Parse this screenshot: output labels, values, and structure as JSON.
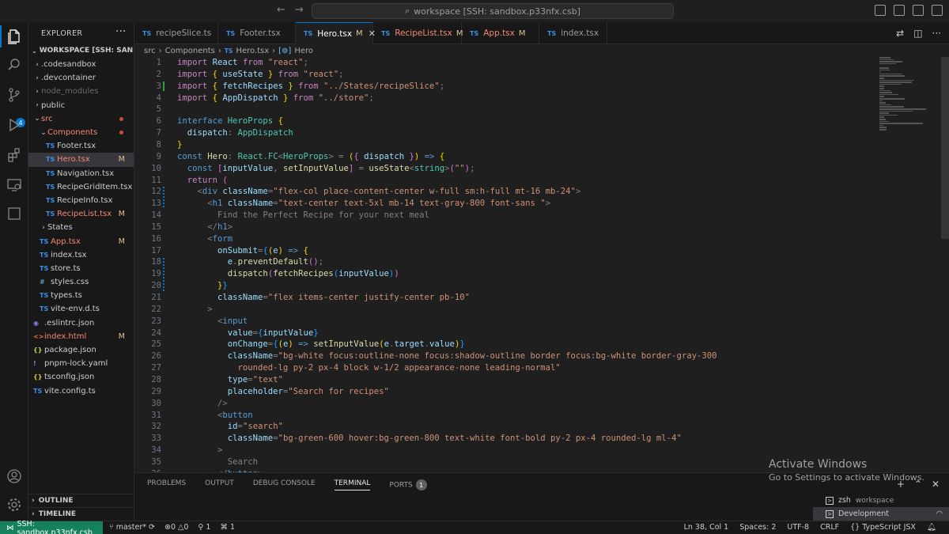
{
  "titlebar": {
    "search_text": "workspace [SSH: sandbox.p33nfx.csb]"
  },
  "activity": {
    "source_control_badge": "4"
  },
  "sidebar": {
    "title": "EXPLORER",
    "workspace": "WORKSPACE [SSH: SANDB...",
    "items": [
      {
        "label": ".codesandbox",
        "type": "folder",
        "indent": 1
      },
      {
        "label": ".devcontainer",
        "type": "folder",
        "indent": 1
      },
      {
        "label": "node_modules",
        "type": "folder",
        "indent": 1,
        "ignored": true
      },
      {
        "label": "public",
        "type": "folder",
        "indent": 1
      },
      {
        "label": "src",
        "type": "folder-open",
        "indent": 1,
        "status": "dot"
      },
      {
        "label": "Components",
        "type": "folder-open",
        "indent": 2,
        "status": "dot"
      },
      {
        "label": "Footer.tsx",
        "type": "ts",
        "indent": 3
      },
      {
        "label": "Hero.tsx",
        "type": "ts",
        "indent": 3,
        "mark": "M",
        "selected": true
      },
      {
        "label": "Navigation.tsx",
        "type": "ts",
        "indent": 3
      },
      {
        "label": "RecipeGridItem.tsx",
        "type": "ts",
        "indent": 3
      },
      {
        "label": "RecipeInfo.tsx",
        "type": "ts",
        "indent": 3
      },
      {
        "label": "RecipeList.tsx",
        "type": "ts",
        "indent": 3,
        "mark": "M"
      },
      {
        "label": "States",
        "type": "folder",
        "indent": 2
      },
      {
        "label": "App.tsx",
        "type": "ts",
        "indent": 2,
        "mark": "M"
      },
      {
        "label": "index.tsx",
        "type": "ts",
        "indent": 2
      },
      {
        "label": "store.ts",
        "type": "ts",
        "indent": 2
      },
      {
        "label": "styles.css",
        "type": "css",
        "indent": 2
      },
      {
        "label": "types.ts",
        "type": "ts",
        "indent": 2
      },
      {
        "label": "vite-env.d.ts",
        "type": "ts",
        "indent": 2
      },
      {
        "label": ".eslintrc.json",
        "type": "eslint",
        "indent": 1
      },
      {
        "label": "index.html",
        "type": "html",
        "indent": 1,
        "mark": "M"
      },
      {
        "label": "package.json",
        "type": "json",
        "indent": 1
      },
      {
        "label": "pnpm-lock.yaml",
        "type": "yaml",
        "indent": 1
      },
      {
        "label": "tsconfig.json",
        "type": "json",
        "indent": 1
      },
      {
        "label": "vite.config.ts",
        "type": "ts",
        "indent": 1
      }
    ],
    "outline": "OUTLINE",
    "timeline": "TIMELINE"
  },
  "tabs": [
    {
      "label": "recipeSlice.ts",
      "state": "normal"
    },
    {
      "label": "Footer.tsx",
      "state": "normal"
    },
    {
      "label": "Hero.tsx",
      "state": "active",
      "mark": "M"
    },
    {
      "label": "RecipeList.tsx",
      "state": "mod2",
      "mark": "M"
    },
    {
      "label": "App.tsx",
      "state": "mod",
      "mark": "M"
    },
    {
      "label": "index.tsx",
      "state": "normal"
    }
  ],
  "breadcrumb": {
    "part1": "src",
    "part2": "Components",
    "part3": "Hero.tsx",
    "part4": "Hero"
  },
  "code_lines": [
    [
      [
        "kw2",
        "import "
      ],
      [
        "var",
        "React "
      ],
      [
        "kw2",
        "from "
      ],
      [
        "str",
        "\"react\""
      ],
      [
        "punc",
        ";"
      ]
    ],
    [
      [
        "kw2",
        "import "
      ],
      [
        "br1",
        "{ "
      ],
      [
        "var",
        "useState "
      ],
      [
        "br1",
        "} "
      ],
      [
        "kw2",
        "from "
      ],
      [
        "str",
        "\"react\""
      ],
      [
        "punc",
        ";"
      ]
    ],
    [
      [
        "kw2",
        "import "
      ],
      [
        "br1",
        "{ "
      ],
      [
        "var",
        "fetchRecipes "
      ],
      [
        "br1",
        "} "
      ],
      [
        "kw2",
        "from "
      ],
      [
        "str",
        "\"../States/recipeSlice\""
      ],
      [
        "punc",
        ";"
      ]
    ],
    [
      [
        "kw2",
        "import "
      ],
      [
        "br1",
        "{ "
      ],
      [
        "var",
        "AppDispatch "
      ],
      [
        "br1",
        "} "
      ],
      [
        "kw2",
        "from "
      ],
      [
        "str",
        "\"../store\""
      ],
      [
        "punc",
        ";"
      ]
    ],
    [],
    [
      [
        "kw",
        "interface "
      ],
      [
        "type",
        "HeroProps "
      ],
      [
        "br1",
        "{"
      ]
    ],
    [
      [
        "var",
        "  dispatch"
      ],
      [
        "punc",
        ": "
      ],
      [
        "type",
        "AppDispatch"
      ]
    ],
    [
      [
        "br1",
        "}"
      ]
    ],
    [
      [
        "kw",
        "const "
      ],
      [
        "fn",
        "Hero"
      ],
      [
        "punc",
        ": "
      ],
      [
        "type",
        "React"
      ],
      [
        "punc",
        "."
      ],
      [
        "type",
        "FC"
      ],
      [
        "punc",
        "<"
      ],
      [
        "type",
        "HeroProps"
      ],
      [
        "punc",
        "> = "
      ],
      [
        "br1",
        "("
      ],
      [
        "br2",
        "{ "
      ],
      [
        "var",
        "dispatch "
      ],
      [
        "br2",
        "}"
      ],
      [
        "br1",
        ") "
      ],
      [
        "kw",
        "=> "
      ],
      [
        "br1",
        "{"
      ]
    ],
    [
      [
        "kw",
        "  const "
      ],
      [
        "br2",
        "["
      ],
      [
        "var",
        "inputValue"
      ],
      [
        "punc",
        ", "
      ],
      [
        "fn",
        "setInputValue"
      ],
      [
        "br2",
        "] "
      ],
      [
        "punc",
        "= "
      ],
      [
        "fn",
        "useState"
      ],
      [
        "punc",
        "<"
      ],
      [
        "type",
        "string"
      ],
      [
        "punc",
        ">"
      ],
      [
        "br2",
        "("
      ],
      [
        "str",
        "\"\""
      ],
      [
        "br2",
        ")"
      ],
      [
        "punc",
        ";"
      ]
    ],
    [
      [
        "kw2",
        "  return "
      ],
      [
        "br2",
        "("
      ]
    ],
    [
      [
        "punc",
        "    <"
      ],
      [
        "tag",
        "div "
      ],
      [
        "attr",
        "className"
      ],
      [
        "punc",
        "="
      ],
      [
        "str",
        "\"flex-col place-content-center w-full sm:h-full mt-16 mb-24\""
      ],
      [
        "punc",
        ">"
      ]
    ],
    [
      [
        "punc",
        "      <"
      ],
      [
        "tag",
        "h1 "
      ],
      [
        "attr",
        "className"
      ],
      [
        "punc",
        "="
      ],
      [
        "str",
        "\"text-center text-5xl mb-14 text-gray-800 font-sans \""
      ],
      [
        "punc",
        ">"
      ]
    ],
    [
      [
        "punc",
        "        Find the Perfect Recipe for your next meal"
      ]
    ],
    [
      [
        "punc",
        "      </"
      ],
      [
        "tag",
        "h1"
      ],
      [
        "punc",
        ">"
      ]
    ],
    [
      [
        "punc",
        "      <"
      ],
      [
        "tag",
        "form"
      ]
    ],
    [
      [
        "attr",
        "        onSubmit"
      ],
      [
        "punc",
        "="
      ],
      [
        "br3",
        "{"
      ],
      [
        "br1",
        "("
      ],
      [
        "var",
        "e"
      ],
      [
        "br1",
        ") "
      ],
      [
        "kw",
        "=> "
      ],
      [
        "br1",
        "{"
      ]
    ],
    [
      [
        "var",
        "          e"
      ],
      [
        "punc",
        "."
      ],
      [
        "fn",
        "preventDefault"
      ],
      [
        "br2",
        "()"
      ],
      [
        "punc",
        ";"
      ]
    ],
    [
      [
        "fn",
        "          dispatch"
      ],
      [
        "br2",
        "("
      ],
      [
        "fn",
        "fetchRecipes"
      ],
      [
        "br3",
        "("
      ],
      [
        "var",
        "inputValue"
      ],
      [
        "br3",
        ")"
      ],
      [
        "br2",
        ")"
      ]
    ],
    [
      [
        "br1",
        "        }"
      ],
      [
        "br3",
        "}"
      ]
    ],
    [
      [
        "attr",
        "        className"
      ],
      [
        "punc",
        "="
      ],
      [
        "str",
        "\"flex items-center justify-center pb-10\""
      ]
    ],
    [
      [
        "punc",
        "      >"
      ]
    ],
    [
      [
        "punc",
        "        <"
      ],
      [
        "tag",
        "input"
      ]
    ],
    [
      [
        "attr",
        "          value"
      ],
      [
        "punc",
        "="
      ],
      [
        "br3",
        "{"
      ],
      [
        "var",
        "inputValue"
      ],
      [
        "br3",
        "}"
      ]
    ],
    [
      [
        "attr",
        "          onChange"
      ],
      [
        "punc",
        "="
      ],
      [
        "br3",
        "{"
      ],
      [
        "br1",
        "("
      ],
      [
        "var",
        "e"
      ],
      [
        "br1",
        ") "
      ],
      [
        "kw",
        "=> "
      ],
      [
        "fn",
        "setInputValue"
      ],
      [
        "br1",
        "("
      ],
      [
        "var",
        "e"
      ],
      [
        "punc",
        "."
      ],
      [
        "var",
        "target"
      ],
      [
        "punc",
        "."
      ],
      [
        "var",
        "value"
      ],
      [
        "br1",
        ")"
      ],
      [
        "br3",
        "}"
      ]
    ],
    [
      [
        "attr",
        "          className"
      ],
      [
        "punc",
        "="
      ],
      [
        "str",
        "\"bg-white focus:outline-none focus:shadow-outline border focus:bg-white border-gray-300"
      ]
    ],
    [
      [
        "str",
        "            rounded-lg py-2 px-4 block w-1/2 appearance-none leading-normal\""
      ]
    ],
    [
      [
        "attr",
        "          type"
      ],
      [
        "punc",
        "="
      ],
      [
        "str",
        "\"text\""
      ]
    ],
    [
      [
        "attr",
        "          placeholder"
      ],
      [
        "punc",
        "="
      ],
      [
        "str",
        "\"Search for recipes\""
      ]
    ],
    [
      [
        "punc",
        "        />"
      ]
    ],
    [
      [
        "punc",
        "        <"
      ],
      [
        "tag",
        "button"
      ]
    ],
    [
      [
        "attr",
        "          id"
      ],
      [
        "punc",
        "="
      ],
      [
        "str",
        "\"search\""
      ]
    ],
    [
      [
        "attr",
        "          className"
      ],
      [
        "punc",
        "="
      ],
      [
        "str",
        "\"bg-green-600 hover:bg-green-800 text-white font-bold py-2 px-4 rounded-lg ml-4\""
      ]
    ],
    [
      [
        "punc",
        "        >"
      ]
    ],
    [
      [
        "punc",
        "          Search"
      ]
    ],
    [
      [
        "punc",
        "        </"
      ],
      [
        "tag",
        "button"
      ],
      [
        "punc",
        ">"
      ]
    ]
  ],
  "panel": {
    "tabs": [
      "PROBLEMS",
      "OUTPUT",
      "DEBUG CONSOLE",
      "TERMINAL",
      "PORTS"
    ],
    "ports_badge": "1",
    "terminals": [
      {
        "name": "zsh",
        "sub": "workspace"
      },
      {
        "name": "Development",
        "sub": ""
      }
    ]
  },
  "watermark": {
    "line1": "Activate Windows",
    "line2": "Go to Settings to activate Windows."
  },
  "statusbar": {
    "remote": "SSH: sandbox.p33nfx.csb",
    "branch": "master*",
    "errors": "0",
    "warnings": "0",
    "ports": "1",
    "info": "1",
    "cursor": "Ln 38, Col 1",
    "spaces": "Spaces: 2",
    "encoding": "UTF-8",
    "eol": "CRLF",
    "language": "TypeScript JSX"
  },
  "colors": {
    "accent": "#0078d4",
    "remote": "#16825d",
    "modified": "#e2c08d"
  }
}
